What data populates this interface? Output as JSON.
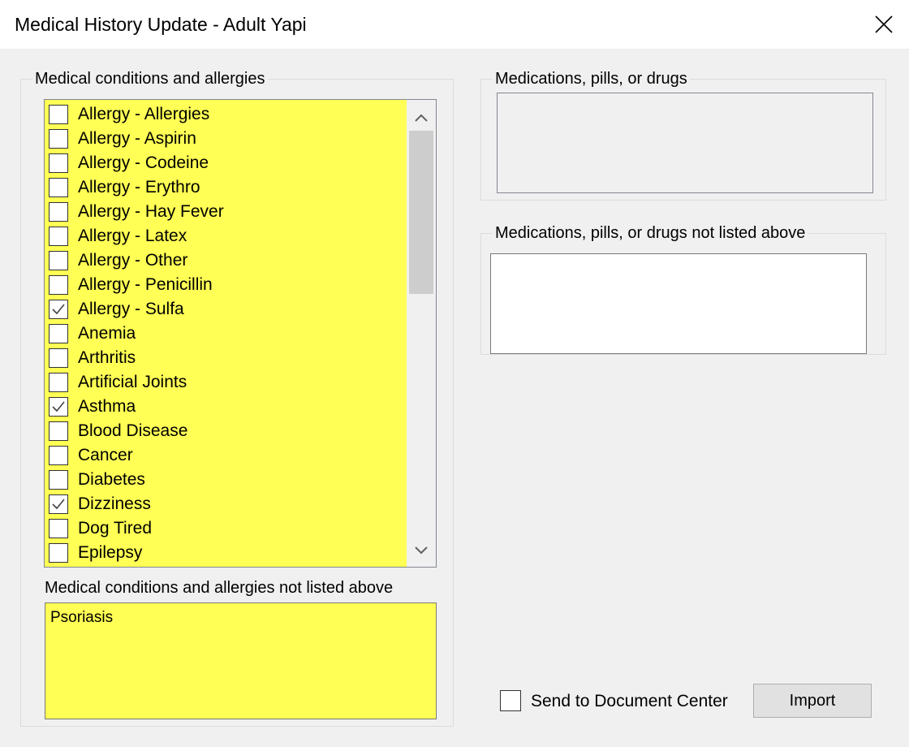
{
  "window": {
    "title": "Medical History Update - Adult Yapi",
    "close_icon": "close-icon"
  },
  "conditions_group": {
    "legend": "Medical conditions and allergies",
    "items": [
      {
        "label": "Allergy - Allergies",
        "checked": false
      },
      {
        "label": "Allergy - Aspirin",
        "checked": false
      },
      {
        "label": "Allergy - Codeine",
        "checked": false
      },
      {
        "label": "Allergy - Erythro",
        "checked": false
      },
      {
        "label": "Allergy - Hay Fever",
        "checked": false
      },
      {
        "label": "Allergy - Latex",
        "checked": false
      },
      {
        "label": "Allergy - Other",
        "checked": false
      },
      {
        "label": "Allergy - Penicillin",
        "checked": false
      },
      {
        "label": "Allergy - Sulfa",
        "checked": true
      },
      {
        "label": "Anemia",
        "checked": false
      },
      {
        "label": "Arthritis",
        "checked": false
      },
      {
        "label": "Artificial Joints",
        "checked": false
      },
      {
        "label": "Asthma",
        "checked": true
      },
      {
        "label": "Blood Disease",
        "checked": false
      },
      {
        "label": "Cancer",
        "checked": false
      },
      {
        "label": "Diabetes",
        "checked": false
      },
      {
        "label": "Dizziness",
        "checked": true
      },
      {
        "label": "Dog Tired",
        "checked": false
      },
      {
        "label": "Epilepsy",
        "checked": false
      }
    ],
    "not_listed_label": "Medical conditions and allergies not listed above",
    "not_listed_value": "Psoriasis"
  },
  "medications_group": {
    "legend": "Medications, pills, or drugs",
    "value": ""
  },
  "medications_other_group": {
    "legend": "Medications, pills, or drugs not listed above",
    "value": ""
  },
  "footer": {
    "send_label": "Send to Document Center",
    "send_checked": false,
    "import_label": "Import"
  },
  "colors": {
    "highlight": "#ffff55",
    "dialog_bg": "#f0f0f0"
  }
}
